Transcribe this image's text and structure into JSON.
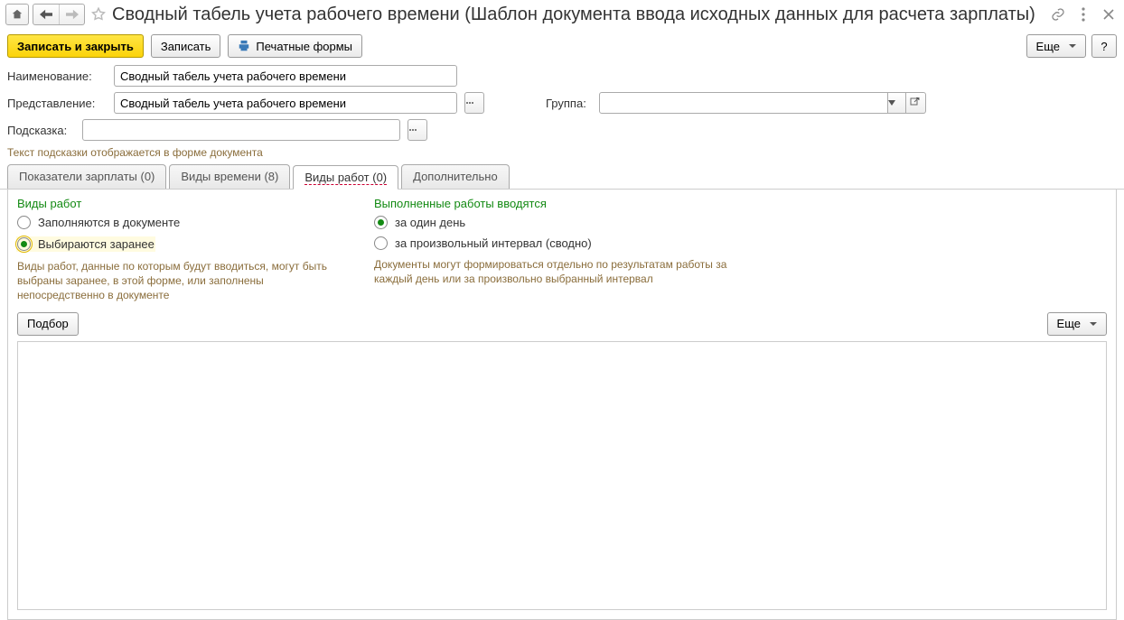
{
  "header": {
    "title": "Сводный табель учета рабочего времени (Шаблон документа ввода исходных данных для расчета зарплаты)"
  },
  "toolbar": {
    "save_and_close": "Записать и закрыть",
    "save": "Записать",
    "print_forms": "Печатные формы",
    "more": "Еще",
    "help": "?"
  },
  "form": {
    "name_label": "Наименование:",
    "name_value": "Сводный табель учета рабочего времени",
    "repr_label": "Представление:",
    "repr_value": "Сводный табель учета рабочего времени",
    "group_label": "Группа:",
    "group_value": "",
    "hint_label": "Подсказка:",
    "hint_value": "",
    "hint_note": "Текст подсказки отображается в форме документа"
  },
  "tabs": [
    {
      "label": "Показатели зарплаты (0)"
    },
    {
      "label": "Виды времени (8)"
    },
    {
      "label": "Виды работ (0)"
    },
    {
      "label": "Дополнительно"
    }
  ],
  "work_types": {
    "group_title": "Виды работ",
    "option1": "Заполняются в документе",
    "option2": "Выбираются заранее",
    "help": "Виды работ, данные по которым будут вводиться, могут быть выбраны заранее, в этой форме, или заполнены непосредственно в документе"
  },
  "work_entry": {
    "group_title": "Выполненные работы вводятся",
    "option1": "за один день",
    "option2": "за произвольный интервал (сводно)",
    "help": "Документы могут формироваться отдельно по результатам работы за каждый день или за произвольно выбранный интервал"
  },
  "sub_toolbar": {
    "select": "Подбор",
    "more": "Еще"
  }
}
